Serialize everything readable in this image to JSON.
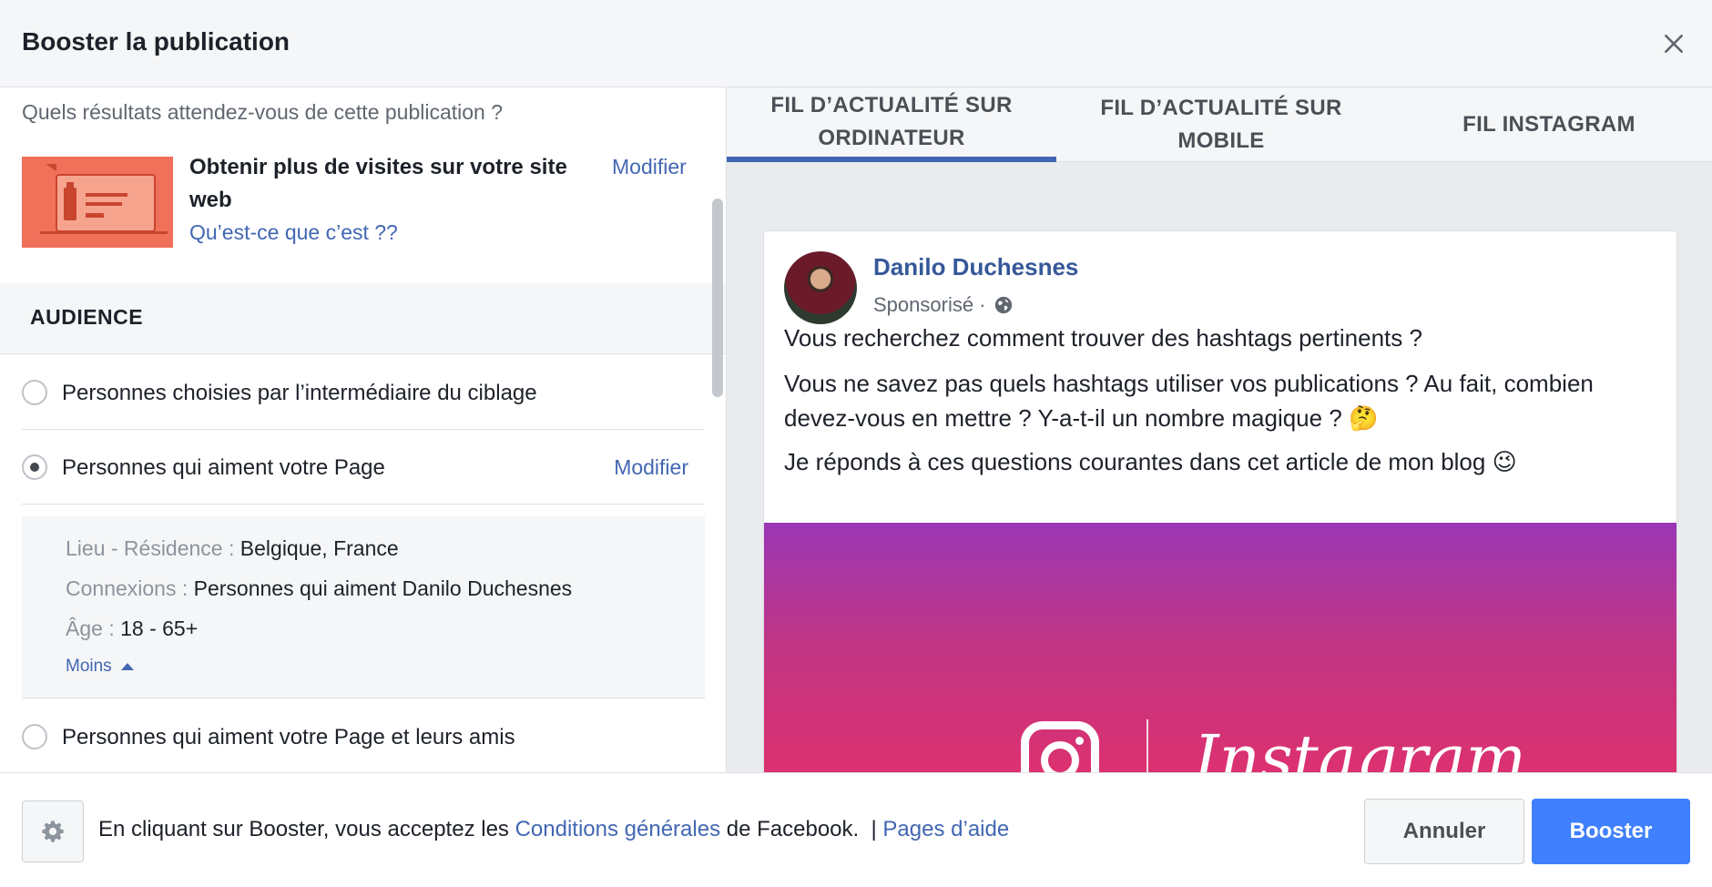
{
  "header": {
    "title": "Booster la publication"
  },
  "goal": {
    "question": "Quels résultats attendez-vous de cette publication ?",
    "title": "Obtenir plus de visites sur votre site web",
    "help_link": "Qu’est-ce que c’est ??",
    "modify_label": "Modifier"
  },
  "audience": {
    "section_title": "AUDIENCE",
    "options": [
      {
        "label": "Personnes choisies par l’intermédiaire du ciblage",
        "selected": false
      },
      {
        "label": "Personnes qui aiment votre Page",
        "selected": true,
        "modify_label": "Modifier"
      },
      {
        "label": "Personnes qui aiment votre Page et leurs amis",
        "selected": false
      }
    ],
    "details": {
      "location_key": "Lieu - Résidence :",
      "location_value": "Belgique, France",
      "connections_key": "Connexions :",
      "connections_value": "Personnes qui aiment Danilo Duchesnes",
      "age_key": "Âge :",
      "age_value": "18 - 65+",
      "less_label": "Moins"
    }
  },
  "preview": {
    "tabs": [
      {
        "label": "FIL D’ACTUALITÉ SUR ORDINATEUR",
        "active": true
      },
      {
        "label": "FIL D’ACTUALITÉ SUR MOBILE",
        "active": false
      },
      {
        "label": "FIL INSTAGRAM",
        "active": false
      }
    ],
    "post": {
      "author": "Danilo Duchesnes",
      "sponsored": "Sponsorisé ·",
      "paragraphs": [
        "Vous recherchez comment trouver des hashtags pertinents ?",
        "Vous ne savez pas quels hashtags utiliser vos publications ? Au fait, combien devez-vous en mettre ? Y-a-t-il un nombre magique ? 🤔",
        "Je réponds à ces questions courantes dans cet article de mon blog 😉"
      ],
      "image_text": "Instagram"
    }
  },
  "footer": {
    "terms_prefix": "En cliquant sur Booster, vous acceptez les",
    "terms_link": "Conditions générales",
    "terms_suffix": "de Facebook.  |",
    "help_link": "Pages d’aide",
    "cancel_label": "Annuler",
    "boost_label": "Booster"
  },
  "colors": {
    "link": "#4267b2",
    "primary_button": "#4080ff",
    "tab_active": "#4267b2"
  }
}
